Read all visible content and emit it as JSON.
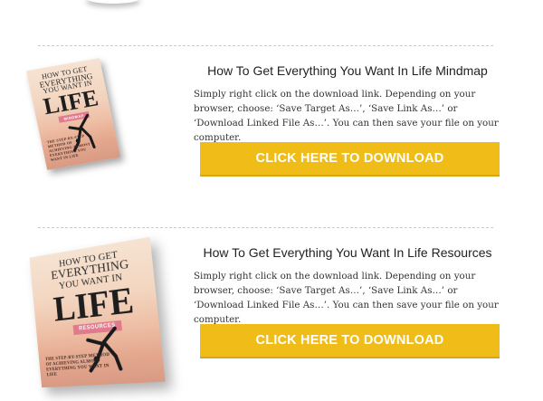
{
  "sections": [
    {
      "title": "How To Get Everything You Want In Life Mindmap",
      "description": "Simply right click on the download link. Depending on your browser, choose: ‘Save Target As…’, ‘Save Link As…’ or ‘Download Linked File As…’. You can then save your file on your computer.",
      "button_label": "CLICK HERE TO DOWNLOAD",
      "cover": {
        "top_line1": "HOW TO GET",
        "top_line2": "EVERYTHING",
        "top_line3": "YOU WANT IN",
        "big_word": "LIFE",
        "ribbon": "MINDMAP",
        "footer": "THE STEP-BY-STEP METHOD OF ACHIEVING ALMOST EVERYTHING YOU WANT IN LIFE"
      }
    },
    {
      "title": "How To Get Everything You Want In Life Resources",
      "description": "Simply right click on the download link. Depending on your browser, choose: ‘Save Target As…’, ‘Save Link As…’ or ‘Download Linked File As…’. You can then save your file on your computer.",
      "button_label": "CLICK HERE TO DOWNLOAD",
      "cover": {
        "top_line1": "HOW TO GET",
        "top_line2": "EVERYTHING",
        "top_line3": "YOU WANT IN",
        "big_word": "LIFE",
        "ribbon": "RESOURCES",
        "footer": "THE STEP-BY-STEP METHOD OF ACHIEVING ALMOST EVERYTHING YOU WANT IN LIFE"
      }
    }
  ],
  "colors": {
    "button": "#f0bd18",
    "button_text": "#ffffff",
    "divider": "#c9c9c9",
    "ribbon": "#e07a8c"
  }
}
